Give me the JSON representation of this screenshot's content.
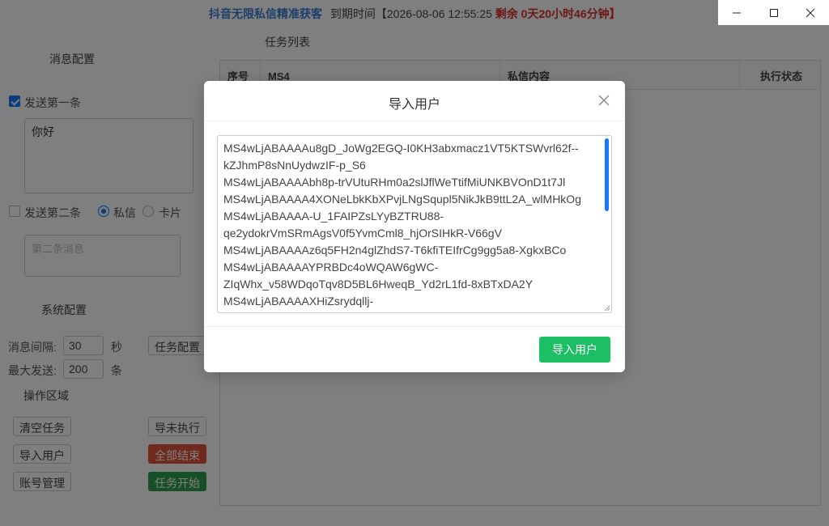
{
  "titlebar": {
    "app_name": "抖音无限私信精准获客",
    "expiry": "到期时间【2026-08-06 12:55:25",
    "remain_label": "剩余",
    "remain_value": "0天20小时46分钟】"
  },
  "window_controls": {
    "minimize": "minimize-icon",
    "maximize": "maximize-icon",
    "close": "close-icon"
  },
  "message_config": {
    "title": "消息配置",
    "first": {
      "label": "发送第一条",
      "checked": true,
      "text": "你好"
    },
    "second": {
      "label": "发送第二条",
      "checked": false,
      "placeholder": "第二条消息"
    },
    "mode": {
      "private_label": "私信",
      "card_label": "卡片",
      "selected": "私信"
    }
  },
  "system_config": {
    "title": "系统配置",
    "interval_label": "消息间隔:",
    "interval_value": "30",
    "interval_unit": "秒",
    "task_config_button": "任务配置",
    "max_label": "最大发送:",
    "max_value": "200",
    "max_unit": "条"
  },
  "operations": {
    "title": "操作区域",
    "clear_tasks": "清空任务",
    "export_pending": "导未执行",
    "import_users": "导入用户",
    "stop_all": "全部结束",
    "account_manage": "账号管理",
    "start_task": "任务开始"
  },
  "task_list": {
    "title": "任务列表",
    "columns": [
      "序号",
      "MS4",
      "私信内容",
      "执行状态"
    ]
  },
  "modal": {
    "title": "导入用户",
    "lines": [
      "MS4wLjABAAAAu8gD_JoWg2EGQ-I0KH3abxmacz1VT5KTSWvrl62f--",
      "kZJhmP8sNnUydwzIF-p_S6",
      "MS4wLjABAAAAbh8p-trVUtuRHm0a2slJflWeTtifMiUNKBVOnD1t7Jl",
      "MS4wLjABAAAA4XONeLbkKbXPvjLNgSqupl5NikJkB9ttL2A_wlMHkOg",
      "MS4wLjABAAAA-U_1FAIPZsLYyBZTRU88-",
      "qe2ydokrVmSRmAgsV0f5YvmCml8_hjOrSIHkR-V66gV",
      "MS4wLjABAAAAz6q5FH2n4glZhdS7-T6kfiTEIfrCg9gg5a8-XgkxBCo",
      "MS4wLjABAAAAYPRBDc4oWQAW6gWC-",
      "ZIqWhx_v58WDqoTqv8D5BL6HweqB_Yd2rL1fd-8xBTxDA2Y",
      "MS4wLjABAAAAXHiZsrydqllj-"
    ],
    "import_button": "导入用户"
  },
  "colors": {
    "accent": "#1677ff",
    "import_green": "#1dbf65",
    "stop_red": "#e0533a",
    "start_green": "#2ea04f"
  }
}
